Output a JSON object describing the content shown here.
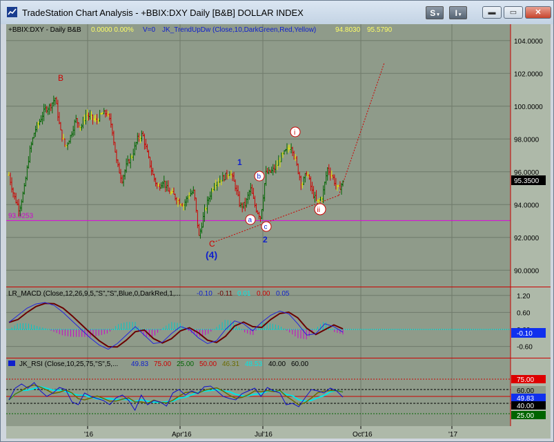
{
  "window": {
    "title": "TradeStation Chart Analysis - +BBIX:DXY Daily [B&B] DOLLAR INDEX",
    "btn_s": "S",
    "btn_i": "I",
    "min_icon": "minimize-icon",
    "max_icon": "maximize-icon",
    "close_icon": "close-icon"
  },
  "price_panel": {
    "header_symbol": "+BBIX:DXY - Daily  B&B",
    "header_change": "0.0000  0.00%",
    "header_volume": "V=0",
    "header_indicator": "JK_TrendUpDw (Close,10,DarkGreen,Red,Yellow)",
    "header_val1": "94.8030",
    "header_val2": "95.5790",
    "last_price": "95.3500",
    "hline_value": 93.0253,
    "hline_label": "93.0253",
    "y_ticks": [
      "104.0000",
      "102.0000",
      "100.0000",
      "98.0000",
      "96.0000",
      "94.0000",
      "92.0000",
      "90.0000"
    ],
    "wave_labels": {
      "B": "B",
      "C": "C",
      "four": "(4)",
      "one": "1",
      "two": "2",
      "a": "a",
      "b": "b",
      "c": "c",
      "i": "i",
      "ii": "ii"
    }
  },
  "macd_panel": {
    "header_name": "LR_MACD (Close,12,26,9,5,\"S\",\"S\",Blue,0,DarkRed,1,...",
    "header_v1": "-0.10",
    "header_v2": "-0.11",
    "header_v3": "0.01",
    "header_v4": "0.00",
    "header_v5": "0.05",
    "y_ticks": [
      "1.20",
      "0.60",
      "0.00",
      "-0.60"
    ],
    "last_value": "-0.10"
  },
  "rsi_panel": {
    "header_name": "JK_RSI (Close,10,25,75,\"S\",5,...",
    "header_v1": "49.83",
    "header_v2": "75.00",
    "header_v3": "25.00",
    "header_v4": "50.00",
    "header_v5": "46.31",
    "header_v6": "48.53",
    "header_v7": "40.00",
    "header_v8": "60.00",
    "tag_75": "75.00",
    "tag_60": "60.00",
    "tag_4983": "49.83",
    "tag_40": "40.00",
    "tag_25": "25.00"
  },
  "x_axis": {
    "labels": [
      "'16",
      "Apr'16",
      "Jul'16",
      "Oct'16",
      "'17"
    ]
  },
  "colors": {
    "plot_bg": "#8f9b8a",
    "up": "#006400",
    "down": "#cc0000",
    "neutral": "#e8e800",
    "macd_line": "#2222dd",
    "signal_line": "#6b0000",
    "rsi_line": "#1010cc",
    "rsi_avg": "#00e8e8"
  },
  "chart_data": {
    "type": "ohlc",
    "title": "+BBIX:DXY Daily [B&B] DOLLAR INDEX",
    "ylim": [
      89,
      105
    ],
    "closes": [
      95.8,
      94.5,
      93.7,
      95.0,
      97.2,
      98.5,
      99.1,
      99.8,
      100.0,
      100.5,
      98.5,
      97.5,
      98.2,
      99.2,
      98.7,
      99.5,
      99.3,
      99.1,
      99.5,
      99.6,
      98.8,
      96.5,
      95.5,
      96.5,
      97.0,
      98.0,
      98.3,
      97.0,
      95.8,
      95.0,
      95.5,
      94.8,
      94.6,
      94.2,
      94.0,
      94.6,
      94.8,
      92.0,
      93.5,
      94.5,
      95.3,
      95.5,
      95.7,
      96.0,
      95.2,
      93.9,
      94.0,
      95.0,
      93.8,
      93.2,
      95.9,
      96.0,
      96.3,
      96.9,
      97.3,
      97.6,
      96.4,
      95.2,
      96.0,
      94.8,
      94.1,
      94.5,
      96.2,
      95.7,
      94.9,
      95.35
    ],
    "legend": []
  }
}
